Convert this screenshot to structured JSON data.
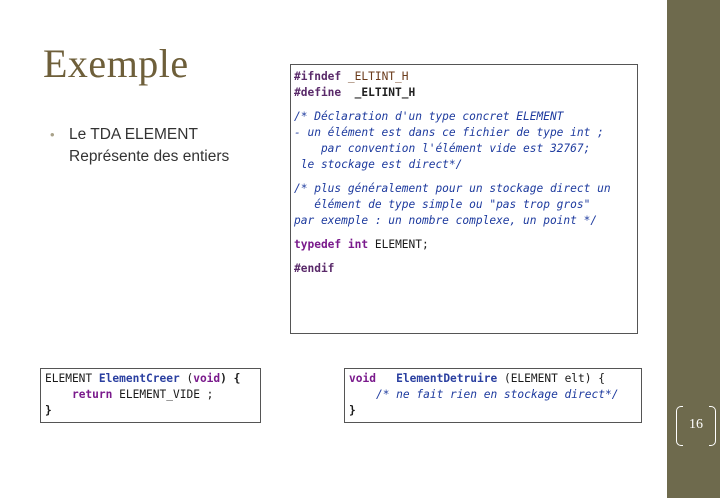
{
  "slide": {
    "title": "Exemple",
    "bullet": "Le TDA ELEMENT Représente des entiers",
    "page_number": "16"
  },
  "code_main": {
    "l1_pp": "#ifndef",
    "l1_rest": " _ELTINT_H",
    "l2_pp": "#define",
    "l2_rest": "  _ELTINT_H",
    "c1": "/* Déclaration d'un type concret ELEMENT",
    "c2": "- un élément est dans ce fichier de type int ;",
    "c3": "    par convention l'élément vide est 32767;",
    "c4": " le stockage est direct*/",
    "c5": "/* plus généralement pour un stockage direct un",
    "c6": "   élément de type simple ou \"pas trop gros\"",
    "c7": "par exemple : un nombre complexe, un point */",
    "td_kw": "typedef",
    "td_int": "int",
    "td_rest": " ELEMENT;",
    "endif": "#endif"
  },
  "code_create": {
    "type": "ELEMENT ",
    "fn": "ElementCreer",
    "open": " (",
    "void": "void",
    "close": ") {",
    "ret_kw": "return",
    "ret_rest": " ELEMENT_VIDE ;",
    "brace": "}"
  },
  "code_destroy": {
    "void": "void",
    "gap": "   ",
    "fn": "ElementDetruire",
    "args": " (ELEMENT elt) {",
    "comment": "/* ne fait rien en stockage direct*/",
    "brace": "}"
  }
}
